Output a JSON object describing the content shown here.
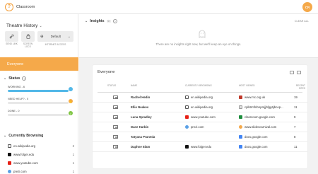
{
  "app": {
    "title": "Classroom",
    "avatar": "CR"
  },
  "sidebar": {
    "class_name": "Theatre History",
    "tools": [
      {
        "label": "SEND LINK",
        "icon": "link-icon"
      },
      {
        "label": "SCREEN LOCK",
        "icon": "lock-icon"
      }
    ],
    "access": {
      "value": "Default",
      "label": "INTERNET ACCESS"
    },
    "everyone": "Everyone",
    "status": {
      "title": "Status",
      "rows": [
        {
          "label": "WORKING - 6",
          "fraction": 1.0,
          "color": "#53b8e8"
        },
        {
          "label": "NEED HELP? - 0",
          "fraction": 0,
          "color": "#f5a94a"
        },
        {
          "label": "DONE - 0",
          "fraction": 0,
          "color": "#7ec542"
        }
      ]
    },
    "browsing": {
      "title": "Currently Browsing",
      "items": [
        {
          "site": "en.wikipedia.org",
          "count": "2",
          "color": "#555555"
        },
        {
          "site": "www.folger.edu",
          "count": "1",
          "color": "#111111"
        },
        {
          "site": "www.youtube.com",
          "count": "1",
          "color": "#e62117"
        },
        {
          "site": "prezi.com",
          "count": "1",
          "color": "#5aa0e6"
        }
      ]
    }
  },
  "insights": {
    "title": "Insights",
    "count": "0",
    "clear_all": "CLEAR ALL",
    "empty_message": "There are no insights right now, but we'll keep an eye on things."
  },
  "roster": {
    "title": "Everyone",
    "columns": [
      "STATUS",
      "NAME",
      "CURRENTLY BROWSING",
      "MOST VIEWED",
      "RECENT SITES"
    ],
    "rows": [
      {
        "name": "Rachel Hedin",
        "browsing": "en.wikipedia.org",
        "browsing_color": "#555555",
        "most_viewed": "www.mc.org.uk",
        "mv_color": "#c0392b",
        "sites": "19"
      },
      {
        "name": "Ellie Noakes",
        "browsing": "en.wikipedia.org",
        "browsing_color": "#555555",
        "most_viewed": "cplktrmfnbnpmjjbfgg6jbcep...",
        "mv_color": "#888888",
        "sites": "11"
      },
      {
        "name": "Luna Spradley",
        "browsing": "www.youtube.com",
        "browsing_color": "#e62117",
        "most_viewed": "classroom.google.com",
        "mv_color": "#1e8e3e",
        "sites": "9"
      },
      {
        "name": "Dane Harbin",
        "browsing": "prezi.com",
        "browsing_color": "#5aa0e6",
        "most_viewed": "www.slidescarnival.com",
        "mv_color": "#f5a94a",
        "sites": "7"
      },
      {
        "name": "Tatyana Pruneda",
        "browsing": "",
        "browsing_color": "",
        "most_viewed": "docs.google.com",
        "mv_color": "#4285f4",
        "sites": "8"
      },
      {
        "name": "Daphne Elam",
        "browsing": "www.folger.edu",
        "browsing_color": "#111111",
        "most_viewed": "docs.google.com",
        "mv_color": "#4285f4",
        "sites": "11"
      }
    ]
  }
}
